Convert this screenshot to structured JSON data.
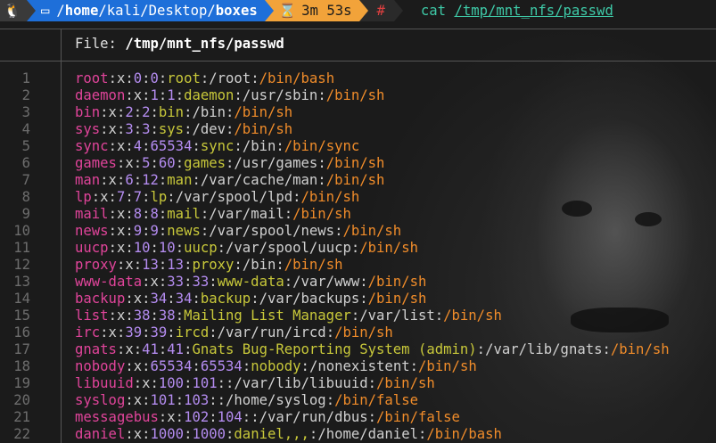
{
  "prompt": {
    "os_icon": "tux-icon",
    "home_icon": "folder-home-icon",
    "path_prefix": "/",
    "path_home": "home",
    "path_mid": "/kali/Desktop/",
    "path_last": "boxes",
    "timer_icon": "hourglass-icon",
    "elapsed": "3m 53s",
    "root_symbol": "#",
    "command": "cat",
    "argument": "/tmp/mnt_nfs/passwd"
  },
  "viewer": {
    "file_label": "File: ",
    "file_name": "/tmp/mnt_nfs/passwd"
  },
  "lines": [
    {
      "n": "1",
      "user": "root",
      "uid": "0",
      "gid": "0",
      "gecos": "root",
      "home": "/root",
      "shell": "/bin/bash"
    },
    {
      "n": "2",
      "user": "daemon",
      "uid": "1",
      "gid": "1",
      "gecos": "daemon",
      "home": "/usr/sbin",
      "shell": "/bin/sh"
    },
    {
      "n": "3",
      "user": "bin",
      "uid": "2",
      "gid": "2",
      "gecos": "bin",
      "home": "/bin",
      "shell": "/bin/sh"
    },
    {
      "n": "4",
      "user": "sys",
      "uid": "3",
      "gid": "3",
      "gecos": "sys",
      "home": "/dev",
      "shell": "/bin/sh"
    },
    {
      "n": "5",
      "user": "sync",
      "uid": "4",
      "gid": "65534",
      "gecos": "sync",
      "home": "/bin",
      "shell": "/bin/sync"
    },
    {
      "n": "6",
      "user": "games",
      "uid": "5",
      "gid": "60",
      "gecos": "games",
      "home": "/usr/games",
      "shell": "/bin/sh"
    },
    {
      "n": "7",
      "user": "man",
      "uid": "6",
      "gid": "12",
      "gecos": "man",
      "home": "/var/cache/man",
      "shell": "/bin/sh"
    },
    {
      "n": "8",
      "user": "lp",
      "uid": "7",
      "gid": "7",
      "gecos": "lp",
      "home": "/var/spool/lpd",
      "shell": "/bin/sh"
    },
    {
      "n": "9",
      "user": "mail",
      "uid": "8",
      "gid": "8",
      "gecos": "mail",
      "home": "/var/mail",
      "shell": "/bin/sh"
    },
    {
      "n": "10",
      "user": "news",
      "uid": "9",
      "gid": "9",
      "gecos": "news",
      "home": "/var/spool/news",
      "shell": "/bin/sh"
    },
    {
      "n": "11",
      "user": "uucp",
      "uid": "10",
      "gid": "10",
      "gecos": "uucp",
      "home": "/var/spool/uucp",
      "shell": "/bin/sh"
    },
    {
      "n": "12",
      "user": "proxy",
      "uid": "13",
      "gid": "13",
      "gecos": "proxy",
      "home": "/bin",
      "shell": "/bin/sh"
    },
    {
      "n": "13",
      "user": "www-data",
      "uid": "33",
      "gid": "33",
      "gecos": "www-data",
      "home": "/var/www",
      "shell": "/bin/sh"
    },
    {
      "n": "14",
      "user": "backup",
      "uid": "34",
      "gid": "34",
      "gecos": "backup",
      "home": "/var/backups",
      "shell": "/bin/sh"
    },
    {
      "n": "15",
      "user": "list",
      "uid": "38",
      "gid": "38",
      "gecos": "Mailing List Manager",
      "home": "/var/list",
      "shell": "/bin/sh"
    },
    {
      "n": "16",
      "user": "irc",
      "uid": "39",
      "gid": "39",
      "gecos": "ircd",
      "home": "/var/run/ircd",
      "shell": "/bin/sh"
    },
    {
      "n": "17",
      "user": "gnats",
      "uid": "41",
      "gid": "41",
      "gecos": "Gnats Bug-Reporting System (admin)",
      "home": "/var/lib/gnats",
      "shell": "/bin/sh"
    },
    {
      "n": "18",
      "user": "nobody",
      "uid": "65534",
      "gid": "65534",
      "gecos": "nobody",
      "home": "/nonexistent",
      "shell": "/bin/sh"
    },
    {
      "n": "19",
      "user": "libuuid",
      "uid": "100",
      "gid": "101",
      "gecos": "",
      "home": "/var/lib/libuuid",
      "shell": "/bin/sh"
    },
    {
      "n": "20",
      "user": "syslog",
      "uid": "101",
      "gid": "103",
      "gecos": "",
      "home": "/home/syslog",
      "shell": "/bin/false"
    },
    {
      "n": "21",
      "user": "messagebus",
      "uid": "102",
      "gid": "104",
      "gecos": "",
      "home": "/var/run/dbus",
      "shell": "/bin/false"
    },
    {
      "n": "22",
      "user": "daniel",
      "uid": "1000",
      "gid": "1000",
      "gecos": "daniel,,,",
      "home": "/home/daniel",
      "shell": "/bin/bash"
    }
  ],
  "colors": {
    "user": "#e0449a",
    "number": "#b48cf0",
    "gecos": "#c8c83a",
    "shell": "#f08c2a",
    "command": "#3ec9a7",
    "dir_segment": "#1e6fd9",
    "timer_segment": "#f2a33a"
  }
}
